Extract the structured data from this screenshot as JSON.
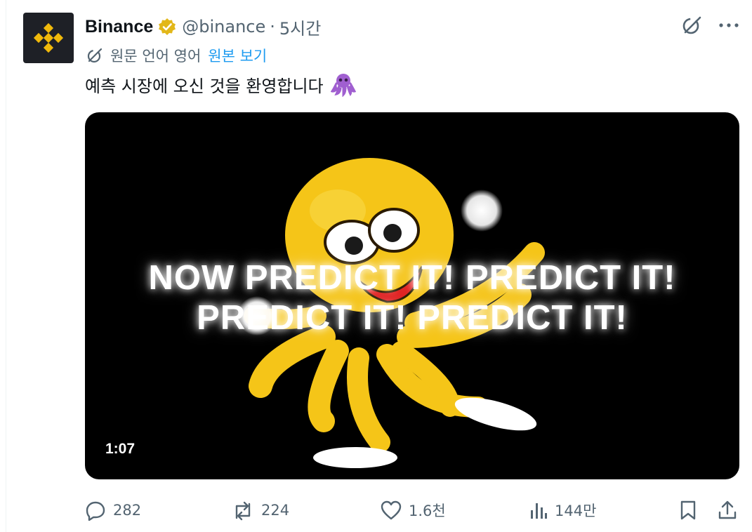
{
  "post": {
    "author_name": "Binance",
    "handle": "@binance",
    "separator": "·",
    "time": "5시간",
    "translate_note": "원문 언어 영어",
    "translate_link": "원본 보기",
    "text": "예측 시장에 오신 것을 환영합니다",
    "emoji": "octopus-emoji"
  },
  "media": {
    "overlay_line1": "NOW PREDICT IT! PREDICT IT!",
    "overlay_line2": "PREDICT IT! PREDICT IT!",
    "duration": "1:07",
    "colors": {
      "octopus": "#f5c518",
      "background": "#000000"
    }
  },
  "actions": {
    "reply_count": "282",
    "repost_count": "224",
    "like_count": "1.6천",
    "views_count": "144만"
  },
  "colors": {
    "brand": "#f0b90b",
    "verified_badge": "#e2b719",
    "link": "#1d9bf0",
    "secondary_text": "#536471"
  }
}
